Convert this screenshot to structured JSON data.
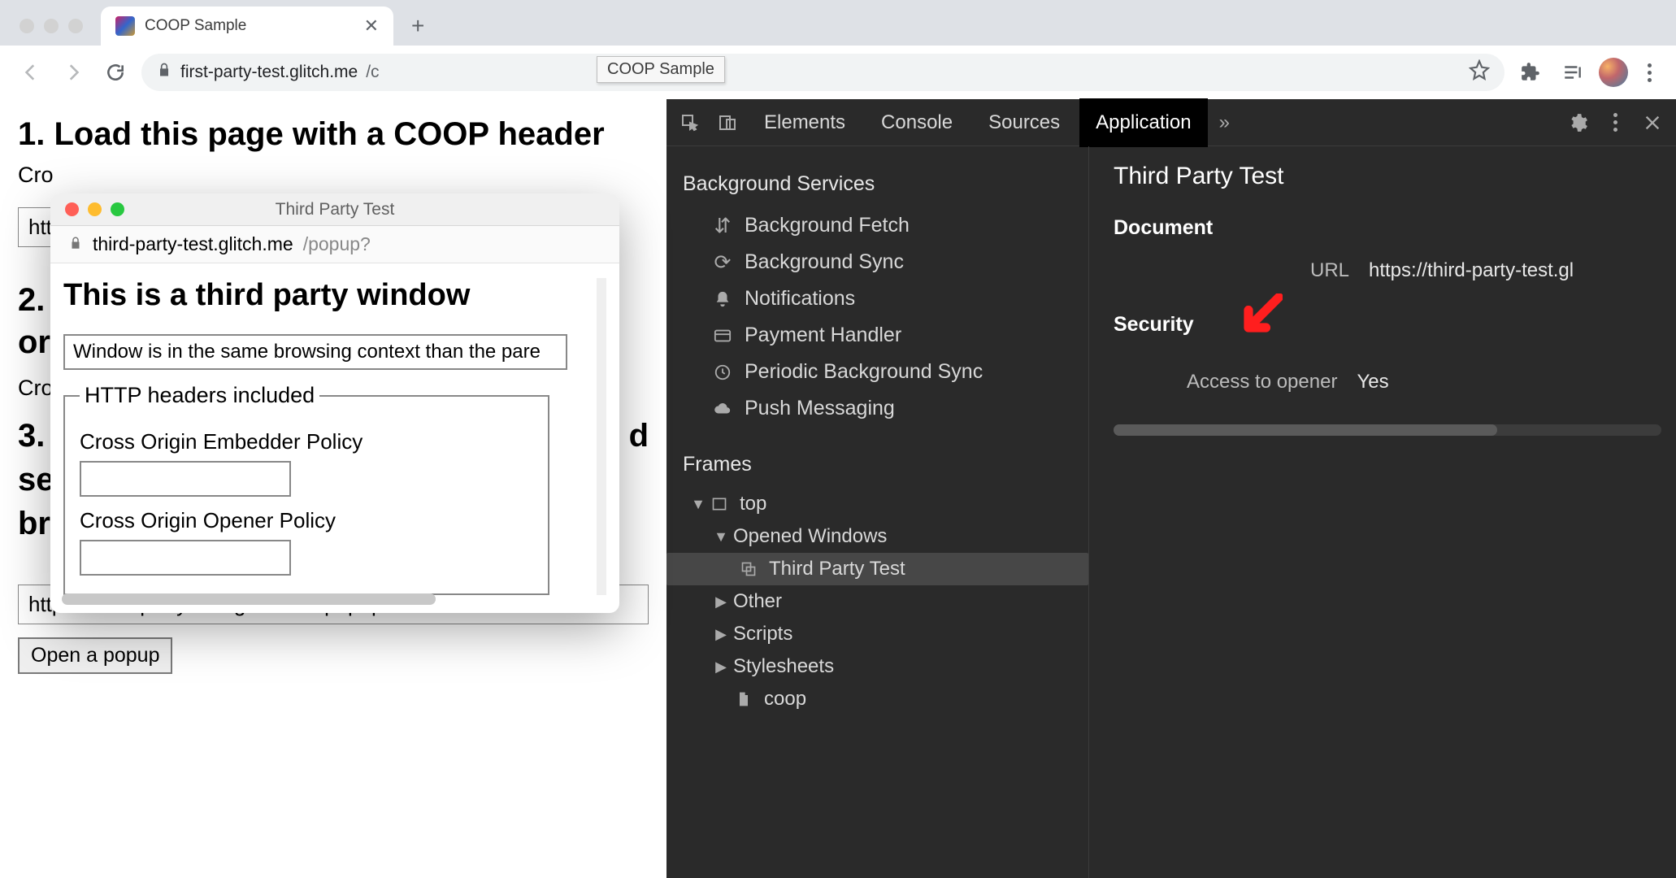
{
  "browser": {
    "tab_title": "COOP Sample",
    "url_host": "first-party-test.glitch.me",
    "url_path": "/c",
    "url_tooltip": "COOP Sample"
  },
  "page": {
    "h1": "1. Load this page with a COOP header",
    "line_cro": "Cro",
    "input1_prefix": "http",
    "h2": "2.",
    "line_or": "or",
    "line_cro2": "Cro",
    "h3_line1": "3.",
    "h3_line2": "se",
    "h3_line3": "br",
    "h3_suffix": "d",
    "popup_url_value": "https://third-party-test.glitch.me/popup?",
    "open_popup_btn": "Open a popup"
  },
  "popup": {
    "title": "Third Party Test",
    "url_host": "third-party-test.glitch.me",
    "url_path": "/popup?",
    "body_h1": "This is a third party window",
    "status_msg": "Window is in the same browsing context than the pare",
    "fieldset_legend": "HTTP headers included",
    "coep_label": "Cross Origin Embedder Policy",
    "coep_value": "",
    "coop_label": "Cross Origin Opener Policy",
    "coop_value": ""
  },
  "devtools": {
    "tabs": {
      "elements": "Elements",
      "console": "Console",
      "sources": "Sources",
      "application": "Application"
    },
    "sidebar": {
      "background_services": "Background Services",
      "bg_fetch": "Background Fetch",
      "bg_sync": "Background Sync",
      "notifications": "Notifications",
      "payment": "Payment Handler",
      "periodic": "Periodic Background Sync",
      "push": "Push Messaging",
      "frames_title": "Frames",
      "top": "top",
      "opened_windows": "Opened Windows",
      "third_party": "Third Party Test",
      "other": "Other",
      "scripts": "Scripts",
      "stylesheets": "Stylesheets",
      "coop": "coop"
    },
    "main": {
      "frame_title": "Third Party Test",
      "doc_heading": "Document",
      "url_label": "URL",
      "url_value": "https://third-party-test.gl",
      "security_heading": "Security",
      "access_label": "Access to opener",
      "access_value": "Yes"
    }
  }
}
